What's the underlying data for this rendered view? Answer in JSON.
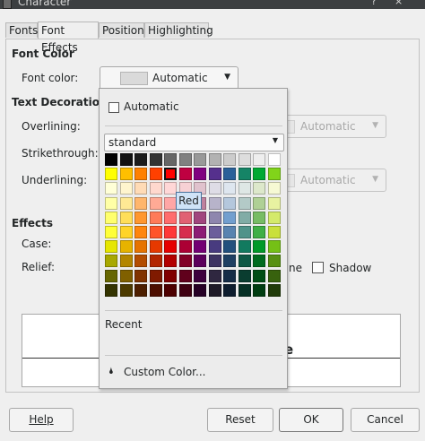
{
  "window": {
    "title": "Character",
    "help_glyph": "?",
    "close_glyph": "×"
  },
  "tabs": [
    {
      "label": "Fonts"
    },
    {
      "label": "Font Effects"
    },
    {
      "label": "Position"
    },
    {
      "label": "Highlighting"
    }
  ],
  "font_color": {
    "section_title": "Font Color",
    "label": "Font color:",
    "value": "Automatic"
  },
  "text_decoration": {
    "section_title": "Text Decoration",
    "overlining_label": "Overlining:",
    "strikethrough_label": "Strikethrough:",
    "underlining_label": "Underlining:",
    "overline_color": "Automatic",
    "underline_color": "Automatic"
  },
  "effects": {
    "section_title": "Effects",
    "case_label": "Case:",
    "relief_label": "Relief:",
    "outline_partial": "ne",
    "shadow_label": "Shadow"
  },
  "preview": {
    "partial_text": "e"
  },
  "buttons": {
    "help": "Help",
    "reset": "Reset",
    "ok": "OK",
    "cancel": "Cancel"
  },
  "popup": {
    "automatic_label": "Automatic",
    "palette_name": "standard",
    "recent_label": "Recent",
    "custom_color_label": "Custom Color...",
    "tooltip": "Red",
    "selected_color": "#ff0000",
    "palette": [
      [
        "#000000",
        "#111111",
        "#1c1c1c",
        "#333333",
        "#666666",
        "#808080",
        "#999999",
        "#b2b2b2",
        "#cccccc",
        "#dddddd",
        "#eeeeee",
        "#ffffff"
      ],
      [
        "#ffff00",
        "#ffbf00",
        "#ff8000",
        "#ff4000",
        "#ff0000",
        "#bf0041",
        "#800080",
        "#55308d",
        "#2a6099",
        "#158466",
        "#00a933",
        "#81d41a"
      ],
      [
        "#ffffd7",
        "#fff5ce",
        "#ffdbb6",
        "#ffd8ce",
        "#ffd7d7",
        "#f7d1d5",
        "#e0c2cd",
        "#dedce6",
        "#dee6ef",
        "#dee7e5",
        "#dde8cb",
        "#f6f9d4"
      ],
      [
        "#ffffa6",
        "#ffe994",
        "#ffb66c",
        "#ffaa95",
        "#ffa6a6",
        "#ec9ba4",
        "#bf819e",
        "#b7b3ca",
        "#b4c7dc",
        "#b3cac7",
        "#afd095",
        "#e8f2a1"
      ],
      [
        "#ffff6d",
        "#ffde59",
        "#ff972f",
        "#ff7b59",
        "#ff6d6d",
        "#e16173",
        "#a1467e",
        "#8e86ae",
        "#729fcf",
        "#81aca6",
        "#77bc65",
        "#d4ea6b"
      ],
      [
        "#ffff38",
        "#ffd428",
        "#ff860d",
        "#ff5429",
        "#ff3838",
        "#d62e4e",
        "#8d1d75",
        "#6b5e9b",
        "#5983b0",
        "#50938a",
        "#3faf46",
        "#c9e03b"
      ],
      [
        "#e6e600",
        "#e6b300",
        "#e67300",
        "#e63900",
        "#e60000",
        "#ac0034",
        "#730073",
        "#483b7f",
        "#23507d",
        "#127a5f",
        "#009929",
        "#75c016"
      ],
      [
        "#a8a800",
        "#b38600",
        "#b34d00",
        "#b32600",
        "#b30000",
        "#820027",
        "#5c005c",
        "#3e3463",
        "#1f4063",
        "#0e5845",
        "#006b1f",
        "#579012"
      ],
      [
        "#666600",
        "#806000",
        "#803300",
        "#801a00",
        "#800000",
        "#60001c",
        "#3e003e",
        "#2f2740",
        "#162d47",
        "#0a3d30",
        "#004d15",
        "#38620e"
      ],
      [
        "#333300",
        "#4d3b00",
        "#4d1f00",
        "#4d0f00",
        "#4d0000",
        "#3f0012",
        "#260026",
        "#1e1a27",
        "#0e1d2e",
        "#063025",
        "#003d11",
        "#203b09"
      ]
    ]
  }
}
